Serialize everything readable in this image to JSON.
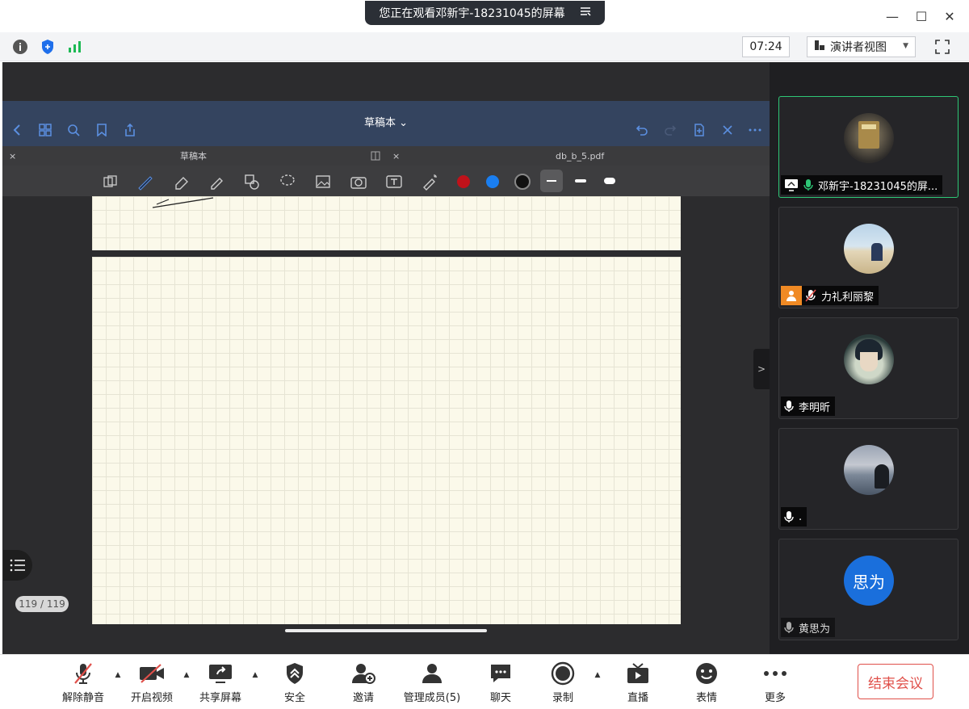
{
  "window": {
    "title": "您正在观看邓新宇-18231045的屏幕",
    "minimize": "—",
    "maximize": "☐",
    "close": "✕"
  },
  "status": {
    "timer": "07:24",
    "view_mode": "演讲者视图",
    "icons": [
      "info-icon",
      "shield-icon",
      "signal-icon"
    ]
  },
  "shared_app": {
    "title": "草稿本 ⌄",
    "tabs": [
      {
        "label": "草稿本"
      },
      {
        "label": "db_b_5.pdf"
      }
    ],
    "page_counter": "119 / 119",
    "pen_colors": [
      "#c0121a",
      "#1a7ef0",
      "#111111"
    ]
  },
  "participants": [
    {
      "name": "邓新宇-18231045的屏...",
      "active": true
    },
    {
      "name": "力礼利丽黎",
      "active": false
    },
    {
      "name": "李明昕",
      "active": false
    },
    {
      "name": ".",
      "active": false
    },
    {
      "name": "黄思为",
      "avatar_text": "思为",
      "active": false
    }
  ],
  "controls": {
    "mute": "解除静音",
    "video": "开启视频",
    "share": "共享屏幕",
    "security": "安全",
    "invite": "邀请",
    "members": "管理成员(5)",
    "chat": "聊天",
    "record": "录制",
    "live": "直播",
    "reaction": "表情",
    "more": "更多",
    "end": "结束会议"
  },
  "colors": {
    "accent_green": "#2ec776",
    "end_red": "#e0504a",
    "app_header": "#34445f",
    "paper": "#fbf9ea"
  }
}
